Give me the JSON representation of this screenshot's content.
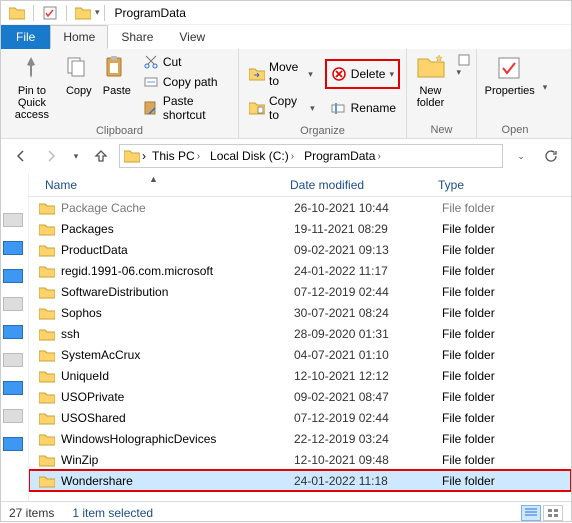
{
  "titlebar": {
    "title": "ProgramData"
  },
  "tabs": {
    "file": "File",
    "home": "Home",
    "share": "Share",
    "view": "View"
  },
  "ribbon": {
    "clipboard": {
      "label": "Clipboard",
      "pin": "Pin to Quick access",
      "copy": "Copy",
      "paste": "Paste",
      "cut": "Cut",
      "copypath": "Copy path",
      "pasteshortcut": "Paste shortcut"
    },
    "organize": {
      "label": "Organize",
      "moveto": "Move to",
      "copyto": "Copy to",
      "delete": "Delete",
      "rename": "Rename"
    },
    "new": {
      "label": "New",
      "newfolder": "New folder"
    },
    "open": {
      "label": "Open",
      "properties": "Properties"
    }
  },
  "breadcrumb": {
    "items": [
      "This PC",
      "Local Disk (C:)",
      "ProgramData"
    ]
  },
  "columns": {
    "name": "Name",
    "date": "Date modified",
    "type": "Type"
  },
  "rows": [
    {
      "name": "Package Cache",
      "date": "26-10-2021 10:44",
      "type": "File folder",
      "dim": true
    },
    {
      "name": "Packages",
      "date": "19-11-2021 08:29",
      "type": "File folder"
    },
    {
      "name": "ProductData",
      "date": "09-02-2021 09:13",
      "type": "File folder"
    },
    {
      "name": "regid.1991-06.com.microsoft",
      "date": "24-01-2022 11:17",
      "type": "File folder"
    },
    {
      "name": "SoftwareDistribution",
      "date": "07-12-2019 02:44",
      "type": "File folder"
    },
    {
      "name": "Sophos",
      "date": "30-07-2021 08:24",
      "type": "File folder"
    },
    {
      "name": "ssh",
      "date": "28-09-2020 01:31",
      "type": "File folder"
    },
    {
      "name": "SystemAcCrux",
      "date": "04-07-2021 01:10",
      "type": "File folder"
    },
    {
      "name": "UniqueId",
      "date": "12-10-2021 12:12",
      "type": "File folder"
    },
    {
      "name": "USOPrivate",
      "date": "09-02-2021 08:47",
      "type": "File folder"
    },
    {
      "name": "USOShared",
      "date": "07-12-2019 02:44",
      "type": "File folder"
    },
    {
      "name": "WindowsHolographicDevices",
      "date": "22-12-2019 03:24",
      "type": "File folder"
    },
    {
      "name": "WinZip",
      "date": "12-10-2021 09:48",
      "type": "File folder"
    },
    {
      "name": "Wondershare",
      "date": "24-01-2022 11:18",
      "type": "File folder",
      "selected": true,
      "framed": true
    }
  ],
  "status": {
    "count": "27 items",
    "selection": "1 item selected"
  }
}
